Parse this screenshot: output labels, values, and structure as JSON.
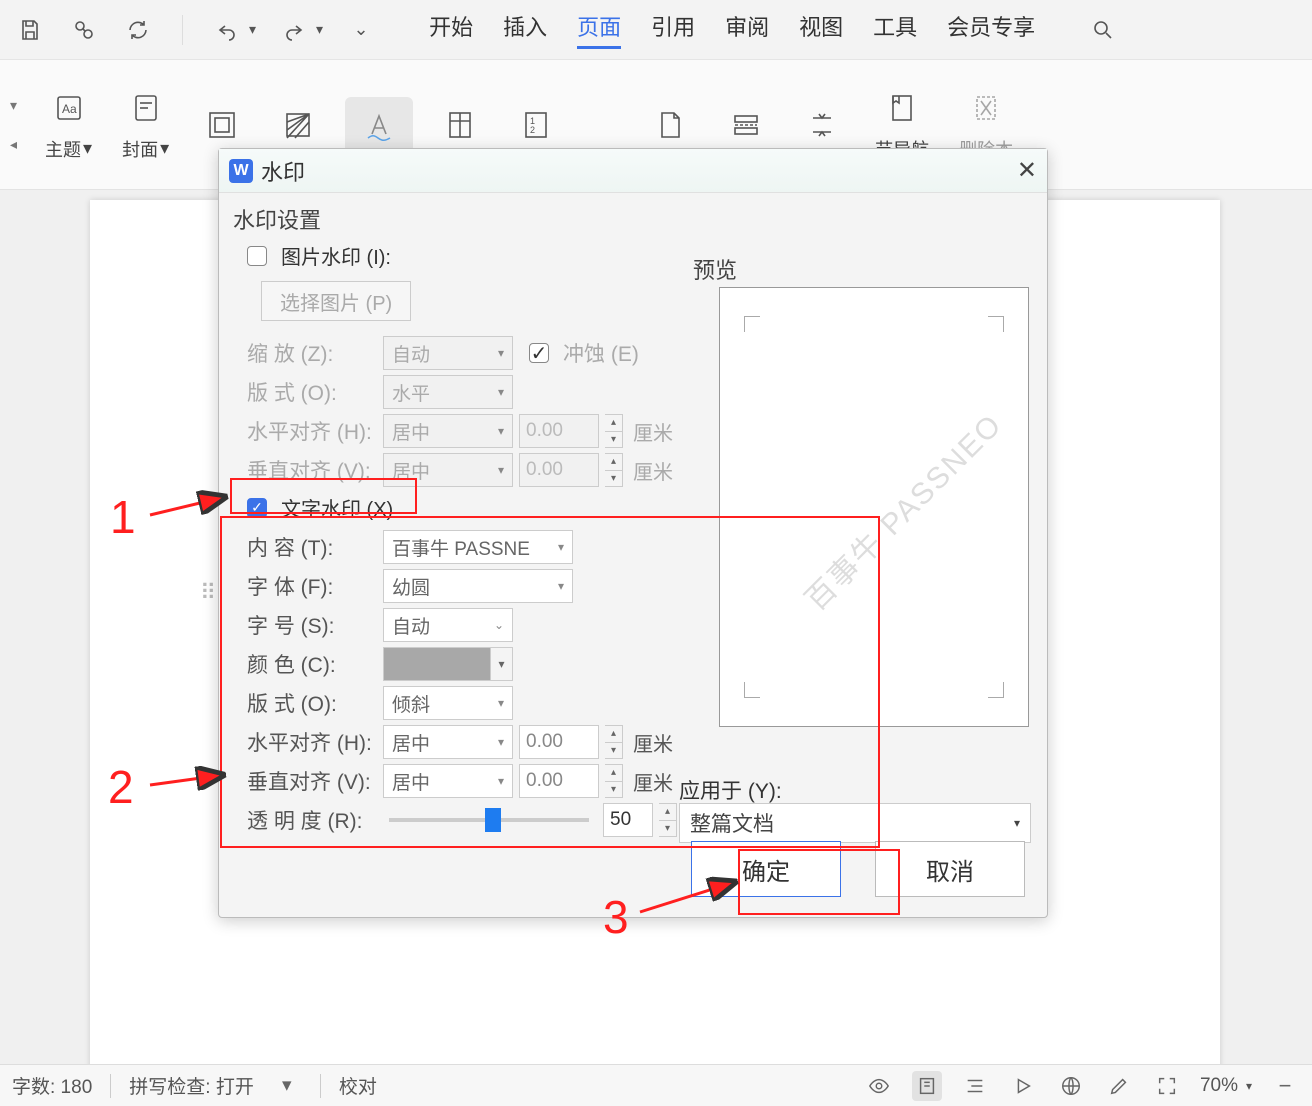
{
  "quickbar": {
    "save_tooltip": "保存",
    "tabs": [
      "开始",
      "插入",
      "页面",
      "引用",
      "审阅",
      "视图",
      "工具",
      "会员专享"
    ],
    "active_tab": 2
  },
  "ribbon": {
    "items": [
      {
        "label": "主题",
        "arrow": true
      },
      {
        "label": "封面",
        "arrow": true
      },
      {
        "label": "",
        "icon": "frame"
      },
      {
        "label": "",
        "icon": "hatch"
      },
      {
        "label": "",
        "icon": "watermark",
        "active": true
      },
      {
        "label": "",
        "icon": "page"
      },
      {
        "label": "",
        "icon": "linenum"
      },
      {
        "label": "",
        "icon": "newpage"
      },
      {
        "label": "",
        "icon": "section"
      },
      {
        "label": "",
        "icon": "collapse"
      },
      {
        "label": "节导航",
        "icon": "nav"
      },
      {
        "label": "删除本",
        "icon": "delete",
        "disabled": true
      }
    ]
  },
  "dialog": {
    "title": "水印",
    "settings_title": "水印设置",
    "pic_watermark_label": "图片水印 (I):",
    "select_pic_btn": "选择图片 (P)",
    "scale_label": "缩    放 (Z):",
    "scale_value": "自动",
    "washout_label": "冲蚀 (E)",
    "layout_label": "版    式 (O):",
    "layout_value": "水平",
    "halign_label": "水平对齐 (H):",
    "halign_value": "居中",
    "halign_num": "0.00",
    "valign_label": "垂直对齐 (V):",
    "valign_value": "居中",
    "valign_num": "0.00",
    "unit_cm": "厘米",
    "text_watermark_label": "文字水印 (X)",
    "content_label": "内    容 (T):",
    "content_value": "百事牛 PASSNE",
    "font_label": "字    体 (F):",
    "font_value": "幼圆",
    "size_label": "字    号 (S):",
    "size_value": "自动",
    "color_label": "颜    色 (C):",
    "layout2_label": "版    式 (O):",
    "layout2_value": "倾斜",
    "halign2_label": "水平对齐 (H):",
    "halign2_value": "居中",
    "halign2_num": "0.00",
    "valign2_label": "垂直对齐 (V):",
    "valign2_value": "居中",
    "valign2_num": "0.00",
    "trans_label": "透 明 度 (R):",
    "trans_value": "50",
    "trans_pct": "%",
    "preview_label": "预览",
    "preview_wm": "百事牛 PASSNEO",
    "apply_label": "应用于 (Y):",
    "apply_value": "整篇文档",
    "ok": "确定",
    "cancel": "取消"
  },
  "annotations": {
    "n1": "1",
    "n2": "2",
    "n3": "3"
  },
  "statusbar": {
    "wordcount": "字数: 180",
    "spellcheck": "拼写检查: 打开",
    "proof": "校对",
    "zoom": "70%"
  }
}
